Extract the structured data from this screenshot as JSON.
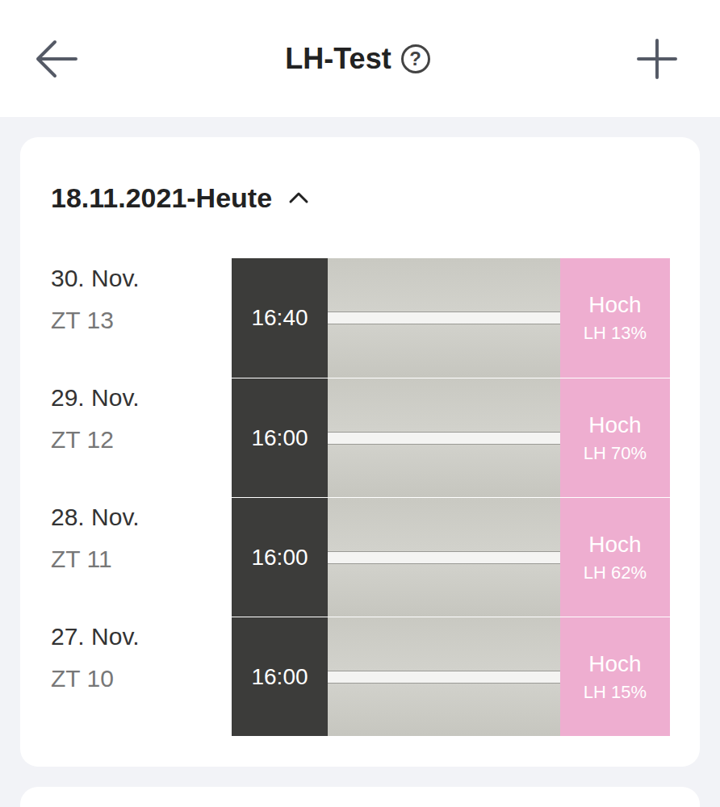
{
  "top_bar": {
    "title": "LH-Test",
    "help": "?"
  },
  "section": {
    "title": "18.11.2021-Heute",
    "expanded": true
  },
  "rows": [
    {
      "date": "30. Nov.",
      "cycle_day": "ZT 13",
      "time": "16:40",
      "result": "Hoch",
      "lh": "LH 13%"
    },
    {
      "date": "29. Nov.",
      "cycle_day": "ZT 12",
      "time": "16:00",
      "result": "Hoch",
      "lh": "LH 70%"
    },
    {
      "date": "28. Nov.",
      "cycle_day": "ZT 11",
      "time": "16:00",
      "result": "Hoch",
      "lh": "LH 62%"
    },
    {
      "date": "27. Nov.",
      "cycle_day": "ZT 10",
      "time": "16:00",
      "result": "Hoch",
      "lh": "LH 15%"
    }
  ]
}
